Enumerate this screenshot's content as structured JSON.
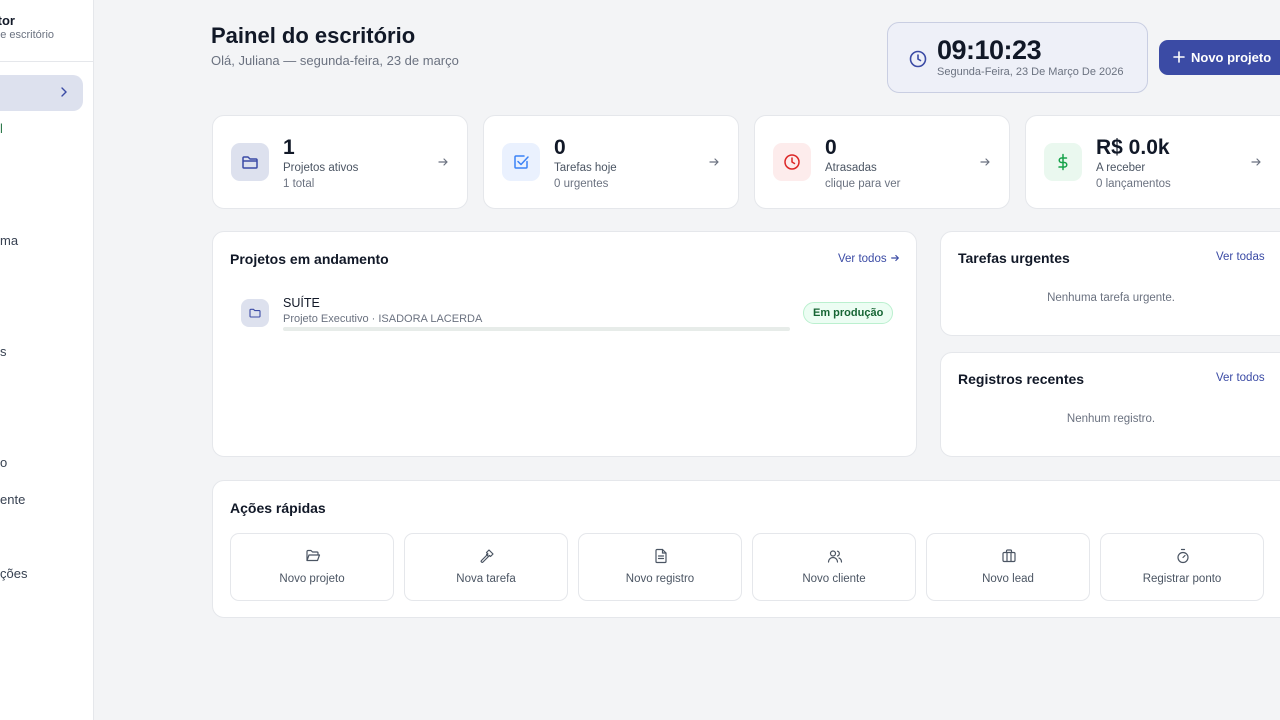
{
  "sidebar": {
    "brand_title": "tor",
    "brand_sub": "e escritório",
    "items": [
      {
        "label": "l"
      },
      {
        "label": "ma"
      },
      {
        "label": "s"
      },
      {
        "label": "o"
      },
      {
        "label": "ente"
      },
      {
        "label": "ções"
      }
    ]
  },
  "header": {
    "title": "Painel do escritório",
    "subtitle": "Olá, Juliana — segunda-feira, 23 de março"
  },
  "clock": {
    "time": "09:10:23",
    "date": "Segunda-Feira, 23 De Março De 2026"
  },
  "new_project_button": "Novo projeto",
  "stats": [
    {
      "value": "1",
      "label": "Projetos ativos",
      "sub": "1 total",
      "icon": "folder-icon",
      "color": "#3b4ba5",
      "bg": "#dde1ee"
    },
    {
      "value": "0",
      "label": "Tarefas hoje",
      "sub": "0 urgentes",
      "icon": "checkbox-icon",
      "color": "#3b82f6",
      "bg": "#eaf1fe"
    },
    {
      "value": "0",
      "label": "Atrasadas",
      "sub": "clique para ver",
      "icon": "clock-icon",
      "color": "#dc2626",
      "bg": "#fdecec"
    },
    {
      "value": "R$ 0.0k",
      "label": "A receber",
      "sub": "0 lançamentos",
      "icon": "dollar-icon",
      "color": "#16a34a",
      "bg": "#eaf8ef"
    }
  ],
  "projects_panel": {
    "title": "Projetos em andamento",
    "link": "Ver todos",
    "items": [
      {
        "name": "SUÍTE",
        "meta": "Projeto Executivo · ISADORA LACERDA",
        "status": "Em produção",
        "progress": 0
      }
    ]
  },
  "urgent_panel": {
    "title": "Tarefas urgentes",
    "link": "Ver todas",
    "empty": "Nenhuma tarefa urgente."
  },
  "records_panel": {
    "title": "Registros recentes",
    "link": "Ver todos",
    "empty": "Nenhum registro."
  },
  "quick_actions": {
    "title": "Ações rápidas",
    "items": [
      {
        "label": "Novo projeto",
        "icon": "folder-open-icon"
      },
      {
        "label": "Nova tarefa",
        "icon": "hammer-icon"
      },
      {
        "label": "Novo registro",
        "icon": "document-icon"
      },
      {
        "label": "Novo cliente",
        "icon": "users-icon"
      },
      {
        "label": "Novo lead",
        "icon": "briefcase-icon"
      },
      {
        "label": "Registrar ponto",
        "icon": "stopwatch-icon"
      }
    ]
  }
}
